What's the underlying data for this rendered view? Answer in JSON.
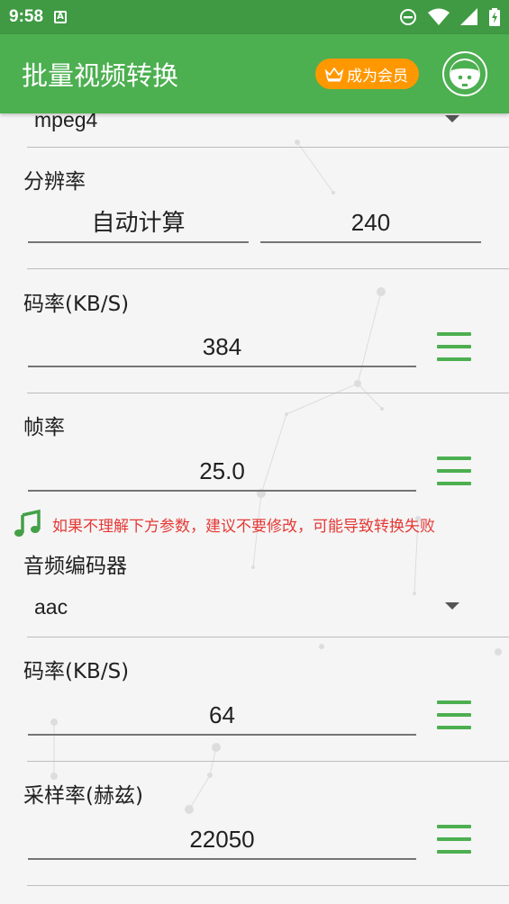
{
  "status_bar": {
    "time": "9:58",
    "notification_icon": "text-notification-icon",
    "notification_letter": "A"
  },
  "app_bar": {
    "title": "批量视频转换",
    "vip_label": "成为会员"
  },
  "video": {
    "codec_value": "mpeg4",
    "resolution_label": "分辨率",
    "resolution_width": "自动计算",
    "resolution_height": "240",
    "bitrate_label": "码率(KB/S)",
    "bitrate_value": "384",
    "framerate_label": "帧率",
    "framerate_value": "25.0"
  },
  "warning_text": "如果不理解下方参数，建议不要修改，可能导致转换失败",
  "audio": {
    "codec_label": "音频编码器",
    "codec_value": "aac",
    "bitrate_label": "码率(KB/S)",
    "bitrate_value": "64",
    "samplerate_label": "采样率(赫兹)",
    "samplerate_value": "22050"
  },
  "colors": {
    "primary": "#4caf50",
    "status_bar": "#3f9a43",
    "accent": "#ff9800",
    "warning": "#e53935"
  }
}
